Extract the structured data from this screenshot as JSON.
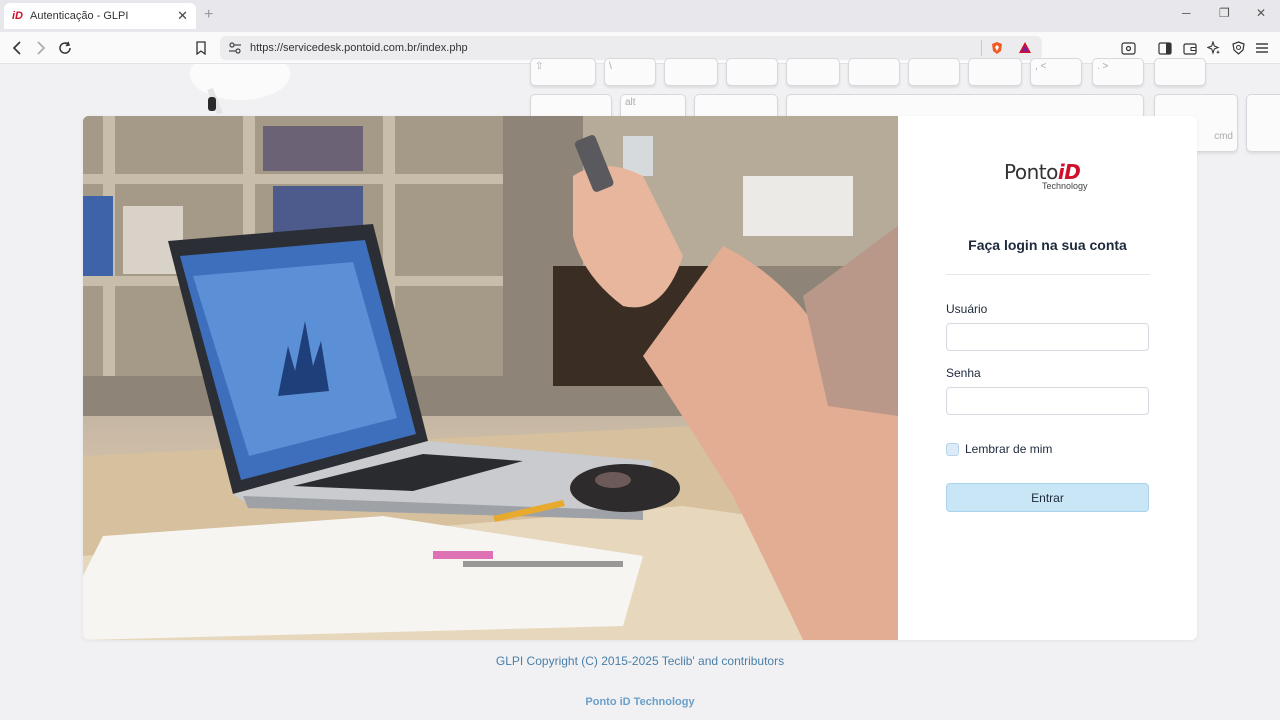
{
  "browser": {
    "tab_title": "Autenticação - GLPI",
    "favicon_text": "iD",
    "url": "https://servicedesk.pontoid.com.br/index.php"
  },
  "logo": {
    "main": "Ponto",
    "accent": "iD",
    "sub": "Technology"
  },
  "login": {
    "title": "Faça login na sua conta",
    "username_label": "Usuário",
    "username_value": "",
    "password_label": "Senha",
    "password_value": "",
    "remember_label": "Lembrar de mim",
    "remember_checked": false,
    "submit_label": "Entrar"
  },
  "footer": {
    "copyright": "GLPI Copyright (C) 2015-2025 Teclib' and contributors",
    "brand": "Ponto iD Technology"
  },
  "colors": {
    "accent_red": "#d0102a",
    "button_bg": "#c9e6f7",
    "link_blue": "#4a7fa8"
  }
}
